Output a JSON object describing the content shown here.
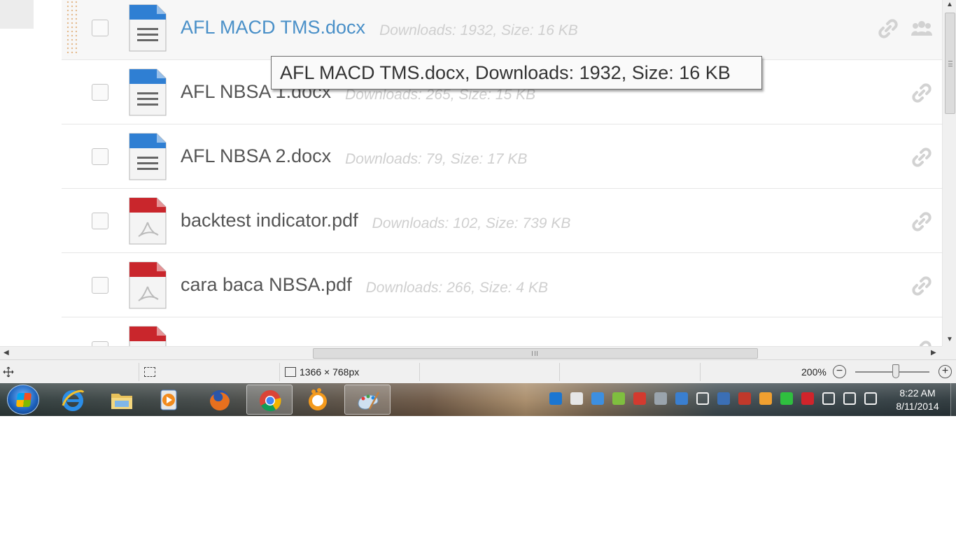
{
  "files": [
    {
      "name": "AFL MACD TMS.docx",
      "meta": "Downloads: 1932, Size: 16 KB",
      "type": "docx",
      "hovered": true
    },
    {
      "name": "AFL NBSA 1.docx",
      "meta": "Downloads: 265, Size: 15 KB",
      "type": "docx",
      "hovered": false
    },
    {
      "name": "AFL NBSA 2.docx",
      "meta": "Downloads: 79, Size: 17 KB",
      "type": "docx",
      "hovered": false
    },
    {
      "name": "backtest indicator.pdf",
      "meta": "Downloads: 102, Size: 739 KB",
      "type": "pdf",
      "hovered": false
    },
    {
      "name": "cara baca NBSA.pdf",
      "meta": "Downloads: 266, Size: 4 KB",
      "type": "pdf",
      "hovered": false
    },
    {
      "name": "",
      "meta": "",
      "type": "pdf",
      "hovered": false
    }
  ],
  "tooltip": {
    "text": "AFL MACD TMS.docx, Downloads: 1932, Size: 16 KB"
  },
  "statusbar": {
    "dimensions": "1366 × 768px",
    "zoom": "200%",
    "zoom_out_label": "−",
    "zoom_in_label": "+",
    "zoom_level": 0.55
  },
  "taskbar": {
    "apps": [
      {
        "name": "internet-explorer",
        "icon": "ie-icon",
        "active": false
      },
      {
        "name": "file-explorer",
        "icon": "folder-icon",
        "active": false
      },
      {
        "name": "media-player",
        "icon": "media-player-icon",
        "active": false
      },
      {
        "name": "firefox",
        "icon": "firefox-icon",
        "active": false
      },
      {
        "name": "chrome",
        "icon": "chrome-icon",
        "active": true
      },
      {
        "name": "messenger",
        "icon": "messenger-icon",
        "active": false
      },
      {
        "name": "paint",
        "icon": "paint-icon",
        "active": true
      }
    ],
    "tray_icons": [
      "teamviewer-icon",
      "action-center-flag-icon",
      "dropbox-icon",
      "sync-icon",
      "colorful-ring-icon",
      "monitor-icon",
      "network-share-icon",
      "bluetooth-icon",
      "disc-icon",
      "cluster-icon",
      "pen-icon",
      "green-arrow-icon",
      "antivirus-icon",
      "volume-icon",
      "power-icon",
      "signal-icon"
    ],
    "clock": {
      "time": "8:22 AM",
      "date": "8/11/2014"
    }
  },
  "colors": {
    "link_blue": "#4a90c8",
    "docx_blue": "#2f7fd3",
    "pdf_red": "#c9262c",
    "meta_gray": "#cfcfcf"
  }
}
